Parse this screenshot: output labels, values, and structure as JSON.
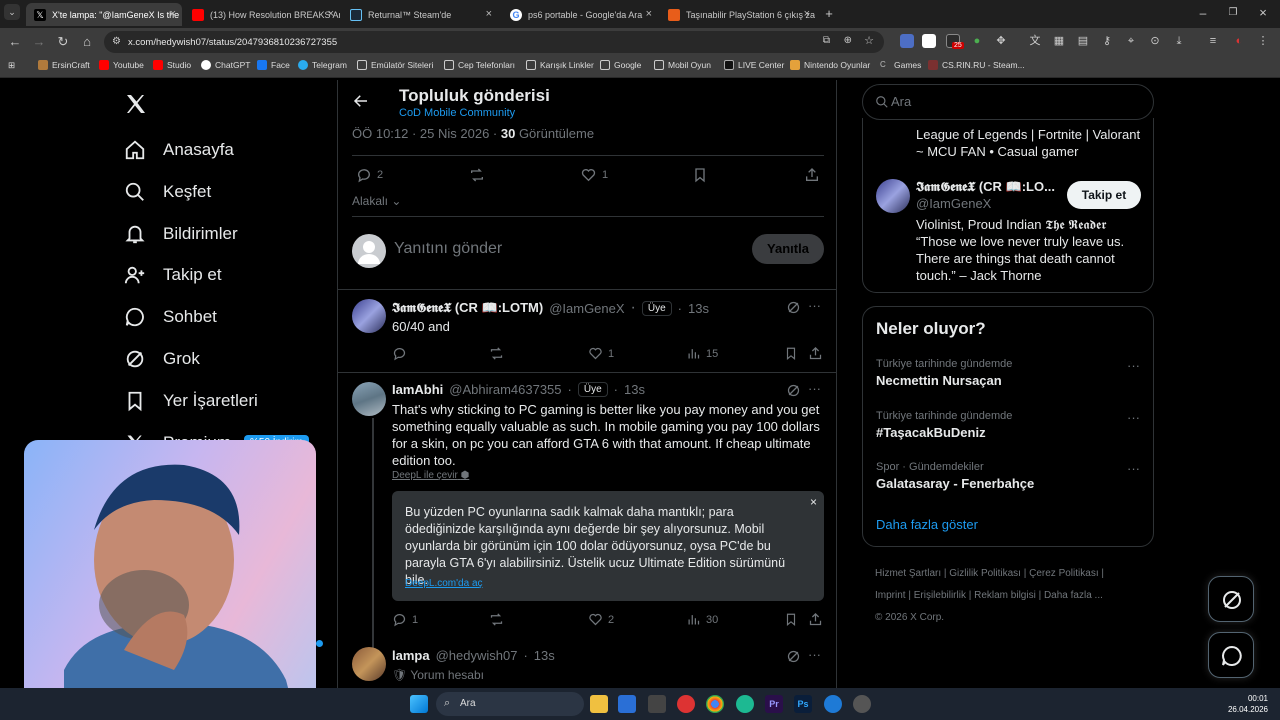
{
  "browser": {
    "tabs": [
      {
        "title": "X'te lampa: \"@IamGeneX Is the",
        "active": true,
        "favicon_color": "#000000"
      },
      {
        "title": "(13) How Resolution BREAKS Ar",
        "active": false,
        "favicon_color": "#ff0000"
      },
      {
        "title": "Returnal™ Steam'de",
        "active": false,
        "favicon_color": "#1b2838"
      },
      {
        "title": "ps6 portable - Google'da Ara",
        "active": false,
        "favicon_color": "#4285f4"
      },
      {
        "title": "Taşınabilir PlayStation 6 çıkış za",
        "active": false,
        "favicon_color": "#e85d1a"
      }
    ],
    "url": "x.com/hedywish07/status/2047936810236727355",
    "bookmarks": [
      "ErsinCraft",
      "Youtube",
      "Studio",
      "ChatGPT",
      "Face",
      "Telegram",
      "Emülatör Siteleri",
      "Cep Telefonları",
      "Karışık Linkler",
      "Google",
      "Mobil Oyun",
      "LIVE Center",
      "Nintendo Oyunlar",
      "Games",
      "CS.RIN.RU - Steam..."
    ],
    "ext_badge": "25"
  },
  "sidebar": {
    "items": [
      {
        "label": "Anasayfa",
        "icon": "home-icon"
      },
      {
        "label": "Keşfet",
        "icon": "search-icon"
      },
      {
        "label": "Bildirimler",
        "icon": "bell-icon"
      },
      {
        "label": "Takip et",
        "icon": "follow-icon"
      },
      {
        "label": "Sohbet",
        "icon": "chat-icon"
      },
      {
        "label": "Grok",
        "icon": "grok-icon"
      },
      {
        "label": "Yer İşaretleri",
        "icon": "bookmark-icon"
      },
      {
        "label": "Premium",
        "icon": "x-icon"
      }
    ],
    "premium_badge": "%50 İndirim"
  },
  "post": {
    "header_title": "Topluluk gönderisi",
    "community": "CoD Mobile Community",
    "meta": "ÖÖ 10:12 · 25 Nis 2026 · ",
    "views_count": "30",
    "views_label": " Görüntüleme",
    "replies": "2",
    "likes": "1",
    "sort_label": "Alakalı",
    "reply_placeholder": "Yanıtını gönder",
    "reply_button": "Yanıtla"
  },
  "replies": [
    {
      "name": "𝕴𝖆𝖒𝕲𝖊𝖓𝖊𝖃 (CR 📖:LOTM)",
      "handle": "@IamGeneX",
      "badge": "Üye",
      "time": "13s",
      "text": "60/40 and",
      "likes": "1",
      "views": "15"
    },
    {
      "name": "IamAbhi",
      "handle": "@Abhiram4637355",
      "badge": "Üye",
      "time": "13s",
      "text": "That's why sticking to PC gaming is better like you pay money and you get something equally valuable as such. In mobile gaming you pay 100 dollars for a skin, on pc you can afford GTA 6 with that amount. If cheap ultimate edition too.",
      "translate_link": "DeepL ile çevir",
      "translation": "Bu yüzden PC oyunlarına sadık kalmak daha mantıklı; para ödediğinizde karşılığında aynı değerde bir şey alıyorsunuz. Mobil oyunlarda bir görünüm için 100 dolar ödüyorsunuz, oysa PC'de bu parayla GTA 6'yı alabilirsiniz. Üstelik ucuz Ultimate Edition sürümünü bile.",
      "deepl_link": "DeepL.com'da aç",
      "replies": "1",
      "likes": "2",
      "views": "30"
    },
    {
      "name": "lampa",
      "handle": "@hedywish07",
      "time": "13s",
      "text": "Yorum hesabı"
    }
  ],
  "right": {
    "search_placeholder": "Ara",
    "bio_top": "League of Legends | Fortnite | Valorant ~ MCU FAN • Casual gamer",
    "profile": {
      "name": "𝕴𝖆𝖒𝕲𝖊𝖓𝖊𝖃 (CR 📖:LO...",
      "handle": "@IamGeneX",
      "follow_button": "Takip et",
      "bio": "Violinist, Proud Indian 𝕿𝖍𝖊 𝕽𝖊𝖆𝖉𝖊𝖗 “Those we love never truly leave us. There are things that death cannot touch.” – Jack Thorne"
    },
    "trends_title": "Neler oluyor?",
    "trends": [
      {
        "category": "Türkiye tarihinde gündemde",
        "name": "Necmettin Nursaçan"
      },
      {
        "category": "Türkiye tarihinde gündemde",
        "name": "#TaşacakBuDeniz"
      },
      {
        "category": "Spor · Gündemdekiler",
        "name": "Galatasaray - Fenerbahçe"
      }
    ],
    "show_more": "Daha fazla göster",
    "footer": [
      "Hizmet Şartları",
      "Gizlilik Politikası",
      "Çerez Politikası",
      "Imprint",
      "Erişilebilirlik",
      "Reklam bilgisi",
      "Daha fazla ...",
      "© 2026 X Corp."
    ]
  },
  "taskbar": {
    "search": "Ara",
    "time": "00:01",
    "date": "26.04.2026"
  }
}
